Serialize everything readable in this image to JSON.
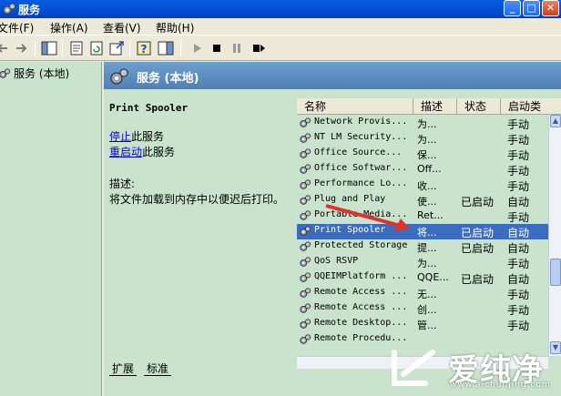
{
  "window": {
    "title": "服务",
    "minimize": "_",
    "maximize": "□",
    "close": "✕"
  },
  "menu": [
    "文件(F)",
    "操作(A)",
    "查看(V)",
    "帮助(H)"
  ],
  "toolbar": [
    "back-icon",
    "forward-icon",
    "console-tree-icon",
    "properties-icon",
    "refresh-icon",
    "export-icon",
    "help-icon",
    "show-hide-icon",
    "start-icon",
    "stop-icon",
    "pause-icon",
    "restart-icon"
  ],
  "tree": {
    "root_label": "服务 (本地)"
  },
  "pane": {
    "header": "服务 (本地)",
    "service_name": "Print Spooler",
    "stop_link": "停止",
    "stop_suffix": "此服务",
    "restart_link": "重启动",
    "restart_suffix": "此服务",
    "desc_label": "描述:",
    "desc_text": "将文件加载到内存中以便迟后打印。"
  },
  "list": {
    "columns": [
      "名称",
      "描述",
      "状态",
      "启动类"
    ],
    "rows": [
      {
        "name": "Network Provis...",
        "desc": "为...",
        "status": "",
        "startup": "手动"
      },
      {
        "name": "NT LM Security...",
        "desc": "为...",
        "status": "",
        "startup": "手动"
      },
      {
        "name": "Office  Source...",
        "desc": "保...",
        "status": "",
        "startup": "手动"
      },
      {
        "name": "Office Softwar...",
        "desc": "Off...",
        "status": "",
        "startup": "手动"
      },
      {
        "name": "Performance Lo...",
        "desc": "收...",
        "status": "",
        "startup": "手动"
      },
      {
        "name": "Plug and Play",
        "desc": "使...",
        "status": "已启动",
        "startup": "自动"
      },
      {
        "name": "Portable Media...",
        "desc": "Ret...",
        "status": "",
        "startup": "手动"
      },
      {
        "name": "Print Spooler",
        "desc": "将...",
        "status": "已启动",
        "startup": "自动",
        "selected": true
      },
      {
        "name": "Protected Storage",
        "desc": "提...",
        "status": "已启动",
        "startup": "自动"
      },
      {
        "name": "QoS RSVP",
        "desc": "为...",
        "status": "",
        "startup": "手动"
      },
      {
        "name": "QQEIMPlatform ...",
        "desc": "QQE...",
        "status": "已启动",
        "startup": "自动"
      },
      {
        "name": "Remote Access ...",
        "desc": "无...",
        "status": "",
        "startup": "手动"
      },
      {
        "name": "Remote Access ...",
        "desc": "创...",
        "status": "",
        "startup": "手动"
      },
      {
        "name": "Remote Desktop...",
        "desc": "管...",
        "status": "",
        "startup": "手动"
      },
      {
        "name": "Remote Procedu...",
        "desc": "",
        "status": "",
        "startup": ""
      }
    ]
  },
  "tabs": [
    "扩展",
    "标准"
  ],
  "watermark": {
    "brand": "爱纯净",
    "url": "www.aichunjing.com"
  },
  "colors": {
    "pane_bg": "#c9e3cc",
    "selection": "#3a6cc0",
    "header_bg": "#4f7fb6",
    "arrow": "#e0322a"
  }
}
